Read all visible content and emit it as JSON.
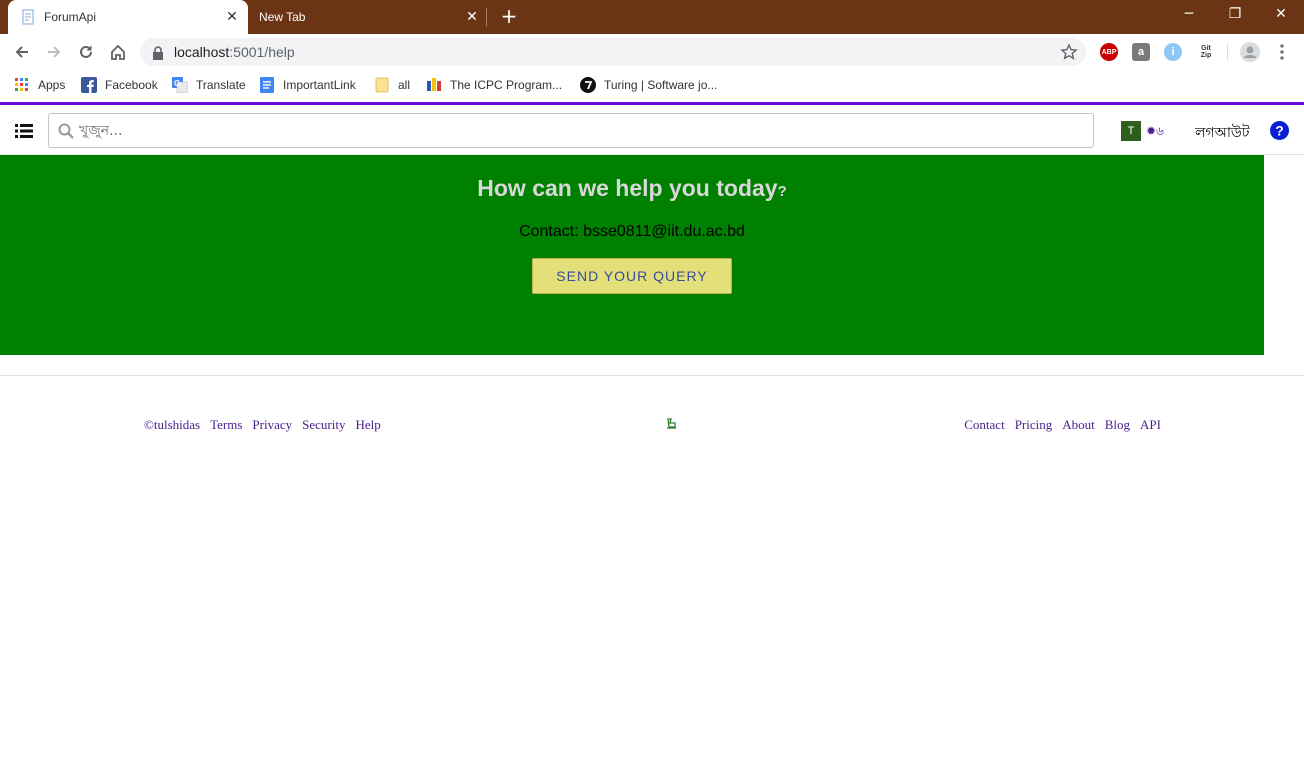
{
  "browser": {
    "tabs": [
      {
        "title": "ForumApi",
        "active": true
      },
      {
        "title": "New Tab",
        "active": false
      }
    ],
    "address": {
      "host": "localhost",
      "rest": ":5001/help"
    },
    "bookmarks": [
      {
        "label": "Apps",
        "icon": "apps-grid-icon"
      },
      {
        "label": "Facebook",
        "icon": "facebook-icon"
      },
      {
        "label": "Translate",
        "icon": "google-translate-icon"
      },
      {
        "label": "ImportantLink",
        "icon": "google-docs-icon"
      },
      {
        "label": "all",
        "icon": "folder-icon"
      },
      {
        "label": "The ICPC Program...",
        "icon": "icpc-icon"
      },
      {
        "label": "Turing | Software jo...",
        "icon": "turing-icon"
      }
    ],
    "extensions": [
      {
        "label": "ABP",
        "color": "#c80000"
      },
      {
        "label": "a",
        "color": "#7a7a7a"
      },
      {
        "label": "i",
        "color": "#8ec6f5"
      },
      {
        "label": "Git Zip",
        "color": "#ffffff"
      }
    ]
  },
  "app": {
    "search": {
      "placeholder": "খুজুন..."
    },
    "user": {
      "avatar_letter": "T",
      "reputation": "✹৬"
    },
    "logout_label": "লগআউট",
    "accent_color": "#6a0dd8"
  },
  "hero": {
    "heading": "How can we help you today",
    "heading_mark": "?",
    "contact": "Contact: bsse0811@iit.du.ac.bd",
    "button_label": "SEND YOUR QUERY",
    "background": "#008000"
  },
  "footer": {
    "left_links": [
      "©tulshidas",
      "Terms",
      "Privacy",
      "Security",
      "Help"
    ],
    "right_links": [
      "Contact",
      "Pricing",
      "About",
      "Blog",
      "API"
    ]
  }
}
